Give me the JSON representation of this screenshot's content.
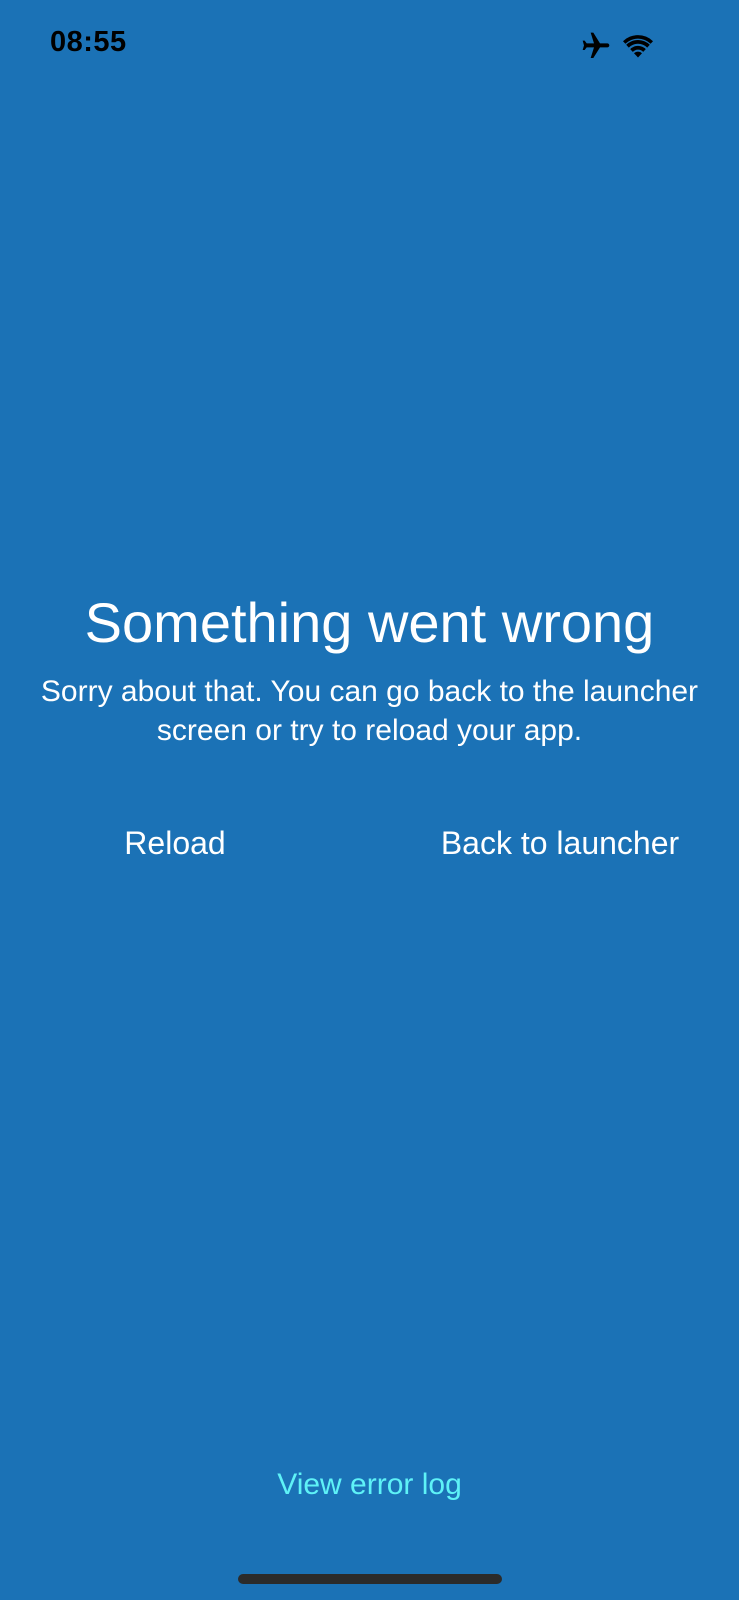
{
  "status_bar": {
    "time": "08:55",
    "icons": [
      "airplane-icon",
      "wifi-icon"
    ]
  },
  "error_screen": {
    "title": "Something went wrong",
    "message": "Sorry about that. You can go back to the launcher screen or try to reload your app.",
    "reload_label": "Reload",
    "back_label": "Back to launcher",
    "error_log_label": "View error log"
  },
  "colors": {
    "background": "#1b72b6",
    "text": "#ffffff",
    "link": "#5ef2f7",
    "status_text": "#000000"
  }
}
